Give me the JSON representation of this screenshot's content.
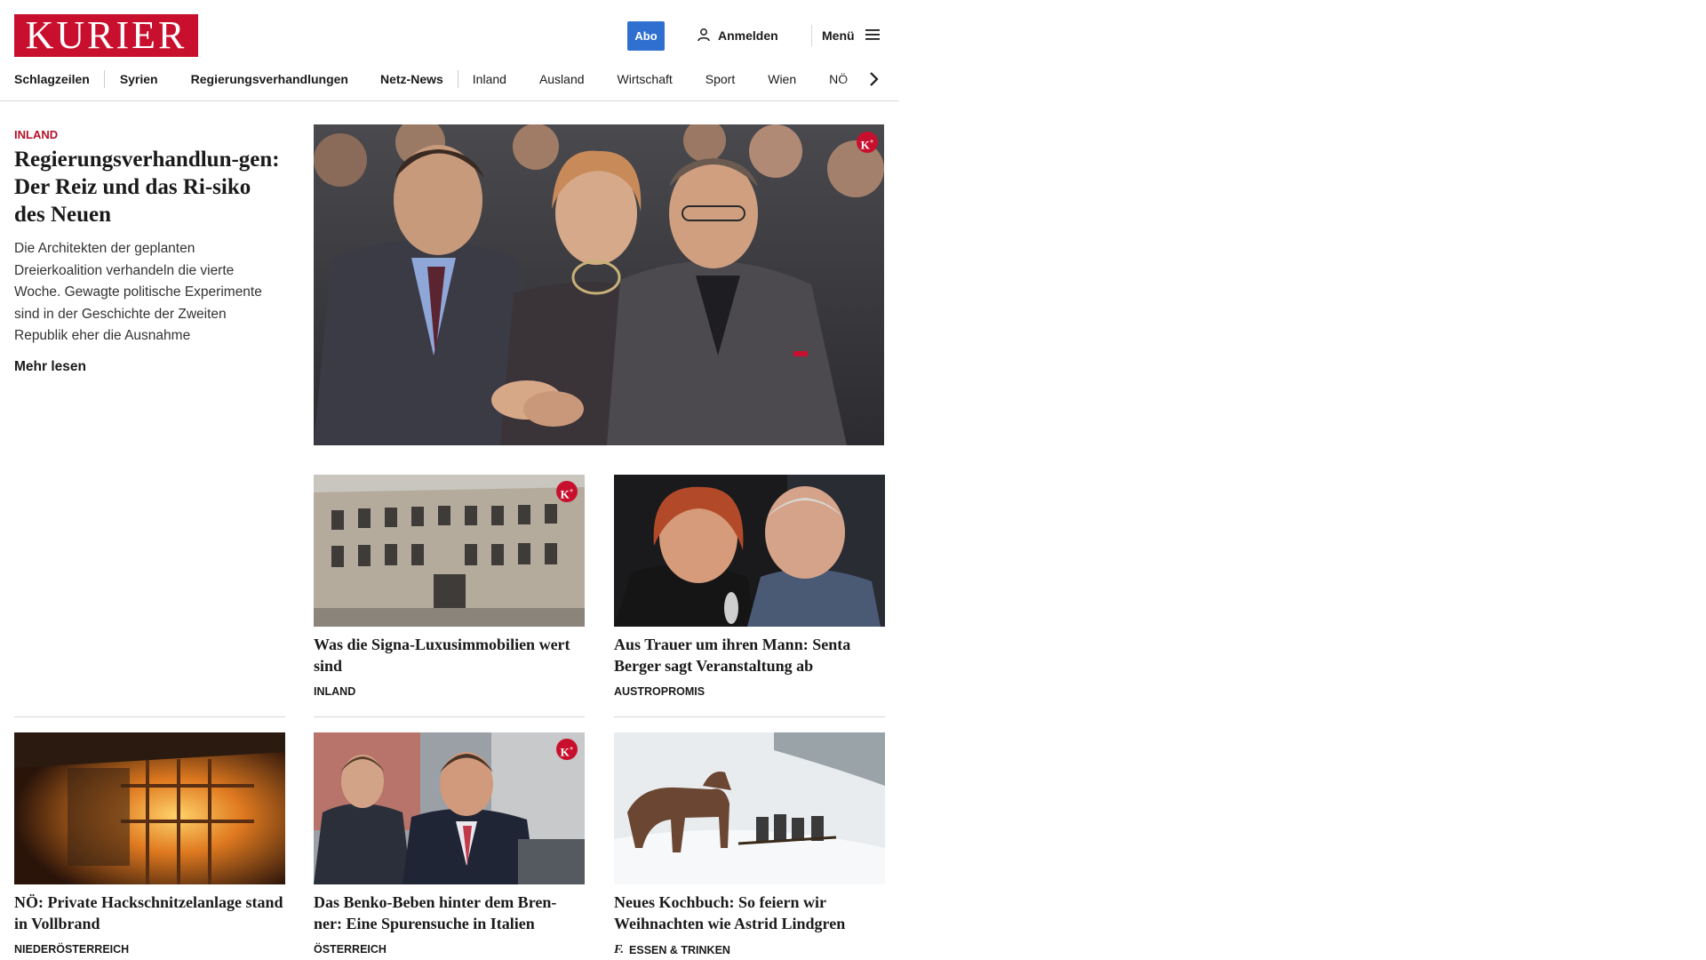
{
  "brand": {
    "logo_text": "KURIER",
    "accent_color": "#c8102e",
    "abo_color": "#2f6fcf"
  },
  "header": {
    "abo_label": "Abo",
    "login_label": "Anmelden",
    "menu_label": "Menü",
    "icons": {
      "login": "user-icon",
      "menu": "hamburger-icon",
      "nav_next": "chevron-right-icon"
    }
  },
  "nav": {
    "items": [
      "Schlagzeilen",
      "Syrien",
      "Regierungsverhandlungen",
      "Netz-News",
      "Inland",
      "Ausland",
      "Wirtschaft",
      "Sport",
      "Wien",
      "NÖ"
    ]
  },
  "lead": {
    "kicker": "INLAND",
    "title": "Regierungsverhandlun-gen: Der Reiz und das Ri-siko des Neuen",
    "text": "Die Architekten der geplanten Dreierkoalition verhandeln die vierte Woche. Gewagte politische Experimente sind in der Geschichte der Zweiten Republik eher die Ausnahme",
    "more_label": "Mehr lesen",
    "premium_badge": "K+"
  },
  "cards": [
    {
      "title": "Was die Signa-Luxusimmobilien wert sind",
      "category": "INLAND",
      "premium": true
    },
    {
      "title": "Aus Trauer um ihren Mann: Senta Berger sagt Veranstaltung ab",
      "category": "AUSTROPROMIS",
      "premium": false
    },
    {
      "title": "NÖ: Private Hackschnitzelanlage stand in Vollbrand",
      "category": "NIEDERÖSTERREICH",
      "premium": false
    },
    {
      "title": "Das Benko-Beben hinter dem Bren-ner: Eine Spurensuche in Italien",
      "category": "ÖSTERREICH",
      "premium": true
    },
    {
      "title": "Neues Kochbuch: So feiern wir Weihnachten wie Astrid Lindgren",
      "category": "ESSEN & TRINKEN",
      "premium": false,
      "category_icon": "freizeit-f-icon"
    }
  ]
}
